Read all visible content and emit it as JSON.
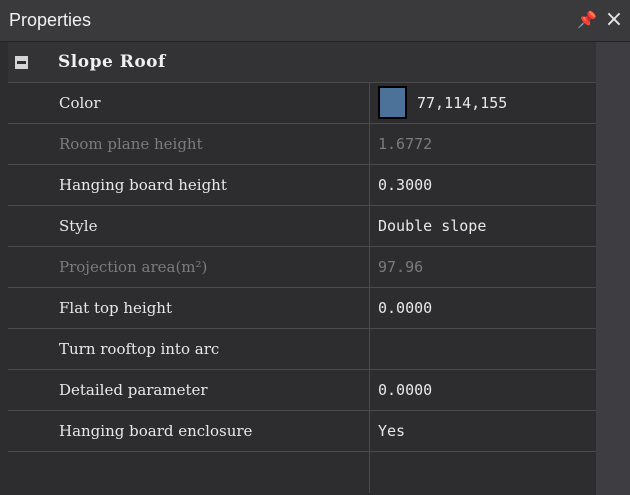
{
  "panel": {
    "title": "Properties",
    "pin_icon": "pin-icon",
    "close_icon": "close-icon"
  },
  "category": {
    "label": "Slope Roof",
    "collapse_icon": "collapse-minus-icon"
  },
  "colors": {
    "swatch": "#4d7299",
    "background": "#2d2d30",
    "disabled_text": "#7c7c7c"
  },
  "properties": [
    {
      "name": "Color",
      "value": "77,114,155",
      "enabled": true
    },
    {
      "name": "Room plane height",
      "value": "1.6772",
      "enabled": false
    },
    {
      "name": "Hanging board height",
      "value": "0.3000",
      "enabled": true
    },
    {
      "name": "Style",
      "value": "Double slope",
      "enabled": true
    },
    {
      "name": "Projection area(m²)",
      "value": "97.96",
      "enabled": false
    },
    {
      "name": "Flat top height",
      "value": "0.0000",
      "enabled": true
    },
    {
      "name": "Turn rooftop into arc",
      "value": "",
      "enabled": true
    },
    {
      "name": "Detailed parameter",
      "value": "0.0000",
      "enabled": true
    },
    {
      "name": "Hanging board enclosure",
      "value": "Yes",
      "enabled": true
    }
  ]
}
